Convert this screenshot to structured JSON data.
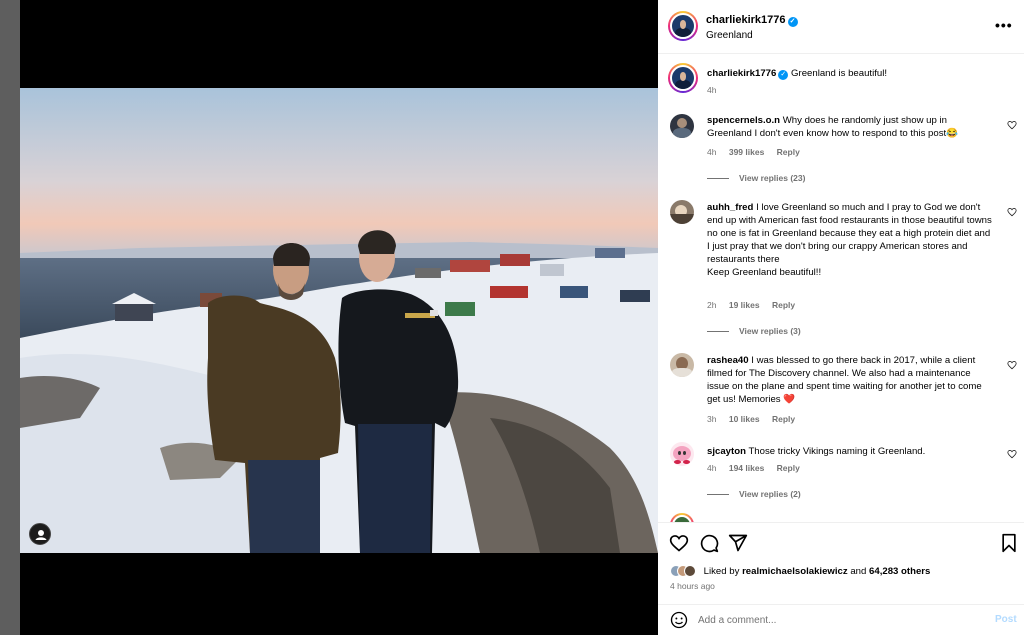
{
  "post": {
    "author": "charliekirk1776",
    "location": "Greenland",
    "caption": "Greenland is beautiful!",
    "caption_age": "4h",
    "more_icon": "more-horizontal-icon"
  },
  "comments": [
    {
      "username": "spencernels.o.n",
      "text": "Why does he randomly just show up in Greenland I don't even know how to respond to this post😂",
      "age": "4h",
      "likes": "399 likes",
      "reply_label": "Reply",
      "view_replies": "View replies (23)"
    },
    {
      "username": "auhh_fred",
      "text": "I love Greenland so much and I pray to God we don't end up with American fast food restaurants in those beautiful towns\nno one is fat in Greenland because they eat a high protein diet and I just pray that we don't bring our crappy American stores and restaurants there\nKeep Greenland beautiful!!",
      "age": "2h",
      "likes": "19 likes",
      "reply_label": "Reply",
      "view_replies": "View replies (3)"
    },
    {
      "username": "rashea40",
      "text": "I was blessed to go there back in 2017, while a client filmed for The Discovery channel. We also had a maintenance issue on the plane and spent time waiting for another jet to come get us! Memories ❤️",
      "age": "3h",
      "likes": "10 likes",
      "reply_label": "Reply",
      "view_replies": ""
    },
    {
      "username": "sjcayton",
      "text": "Those tricky Vikings naming it Greenland.",
      "age": "4h",
      "likes": "194 likes",
      "reply_label": "Reply",
      "view_replies": "View replies (2)"
    }
  ],
  "actions": {
    "liked_by_prefix": "Liked by",
    "liked_by_user": "realmichaelsolakiewicz",
    "liked_by_and": "and",
    "others": "64,283 others",
    "time_ago": "4 hours ago"
  },
  "composer": {
    "placeholder": "Add a comment...",
    "post_label": "Post"
  },
  "colors": {
    "accent": "#0095f6",
    "like_red": "#ed4956",
    "muted": "#737373"
  }
}
